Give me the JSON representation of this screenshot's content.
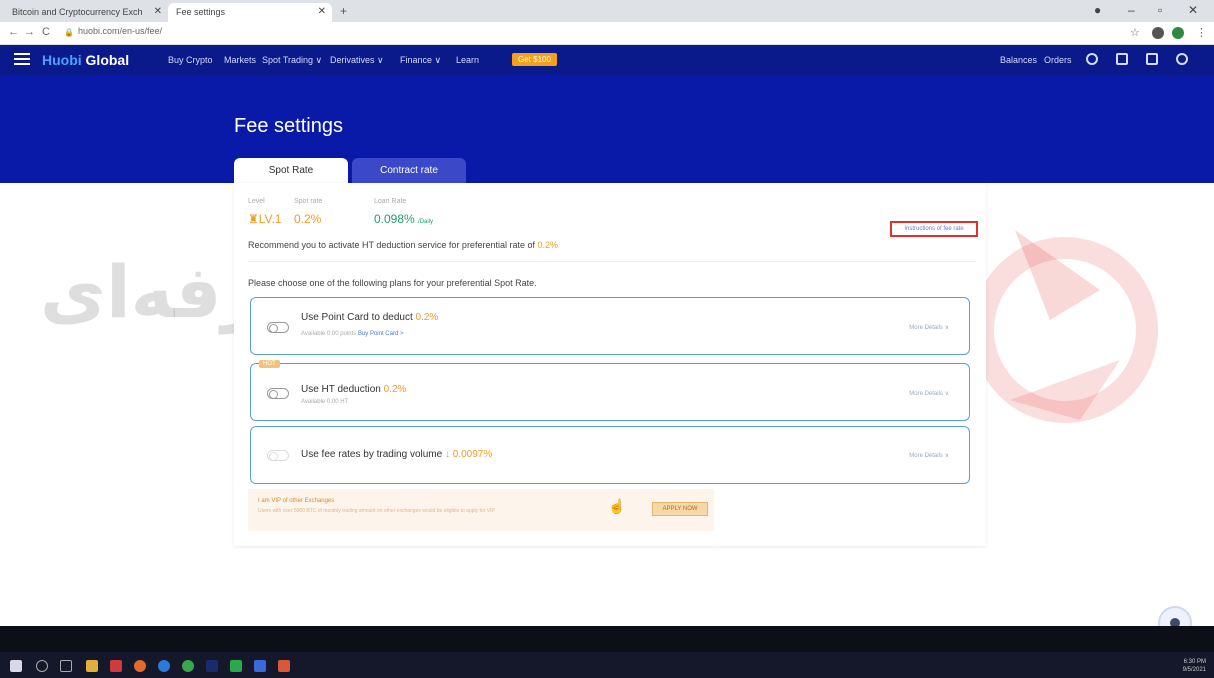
{
  "browser": {
    "tabs": [
      {
        "label": "Bitcoin and Cryptocurrency Exch"
      },
      {
        "label": "Fee settings"
      }
    ],
    "url": "huobi.com/en-us/fee/"
  },
  "nav": {
    "logo_a": "Huobi",
    "logo_b": "Global",
    "items": [
      "Buy Crypto",
      "Markets",
      "Spot Trading ∨",
      "Derivatives ∨",
      "Finance ∨",
      "Learn"
    ],
    "new_badge": "Get $100",
    "right_items": [
      "Balances",
      "Orders"
    ]
  },
  "page": {
    "title": "Fee settings",
    "tabs": [
      "Spot Rate",
      "Contract rate"
    ]
  },
  "level": {
    "level_label": "Level",
    "level_value": "LV.1",
    "spot_label": "Spot rate",
    "spot_value": "0.2%",
    "loan_label": "Loan Rate",
    "loan_value": "0.098%",
    "loan_unit": "/Daily",
    "instructions": "Instructions of fee rate",
    "recommend_prefix": "Recommend you to activate HT deduction service for preferential rate of",
    "recommend_rate": "0.2%"
  },
  "plans": {
    "intro": "Please choose one of the following plans for your preferential Spot Rate.",
    "point_card": {
      "title": "Use Point Card to deduct",
      "rate": "0.2%",
      "sub": "Available 0.00 points",
      "link": "Buy Point Card >",
      "more": "More Details ∨"
    },
    "ht": {
      "tag": "HOT",
      "title": "Use HT deduction",
      "rate": "0.2%",
      "sub": "Available 0.00 HT",
      "more": "More Details ∨"
    },
    "volume": {
      "title": "Use fee rates by trading volume",
      "rate": "↓ 0.0097%",
      "more": "More Details ∨"
    }
  },
  "vip": {
    "title": "I am VIP of other Exchanges",
    "desc": "Users with over 5000 BTC of monthly trading amount on other exchanges would be eligible to apply for VIP",
    "apply": "APPLY NOW"
  },
  "watermark": {
    "text": "فارکس حرفه‌ای"
  },
  "taskbar": {
    "time": "6:30 PM",
    "date": "9/5/2021"
  }
}
